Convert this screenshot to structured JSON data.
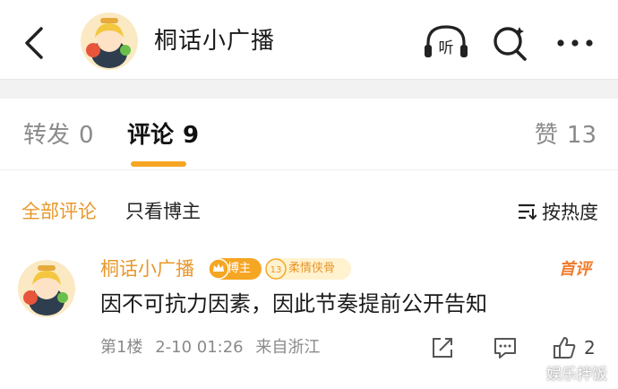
{
  "header": {
    "title": "桐话小广播",
    "listen_label": "听"
  },
  "tabs": [
    {
      "label": "转发",
      "count": "0"
    },
    {
      "label": "评论",
      "count": "9"
    },
    {
      "label": "赞",
      "count": "13"
    }
  ],
  "filters": {
    "all": "全部评论",
    "blogger_only": "只看博主",
    "sort": "按热度"
  },
  "comment": {
    "author": "桐话小广播",
    "badge_blogger": "博主",
    "badge_fan_level": "13",
    "badge_fan": "柔情侠骨",
    "tag": "首评",
    "text": "因不可抗力因素，因此节奏提前公开告知",
    "floor": "第1楼",
    "time": "2-10 01:26",
    "location": "来自浙江",
    "likes": "2"
  },
  "watermark": "娱乐拌饭",
  "colors": {
    "accent": "#f5a623",
    "author": "#e8972a",
    "tag": "#f07c2c"
  }
}
